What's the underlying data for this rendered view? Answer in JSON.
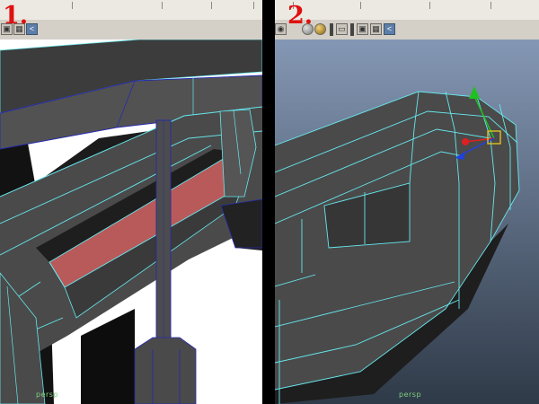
{
  "panel1": {
    "step_label": "1.",
    "camera_label": "persp",
    "toolbar_icons": [
      "cube-icon",
      "grid-icon",
      "share-icon"
    ]
  },
  "panel2": {
    "step_label": "2.",
    "camera_label": "persp",
    "toolbar_icons": [
      "camera-icon",
      "sphere-shaded-icon",
      "sphere-textured-icon",
      "light-icon",
      "resolution-gate-icon",
      "light-2-icon",
      "cube-icon",
      "grid-icon",
      "share-icon"
    ]
  },
  "colors": {
    "mesh_face": "#4a4a4a",
    "mesh_dark": "#262626",
    "wireframe": "#66e8ee",
    "selected_face": "#b85a5a",
    "viewport_bg_top": "#8497b4",
    "viewport_bg_bottom": "#2f3a48",
    "step_label": "#e01010"
  }
}
